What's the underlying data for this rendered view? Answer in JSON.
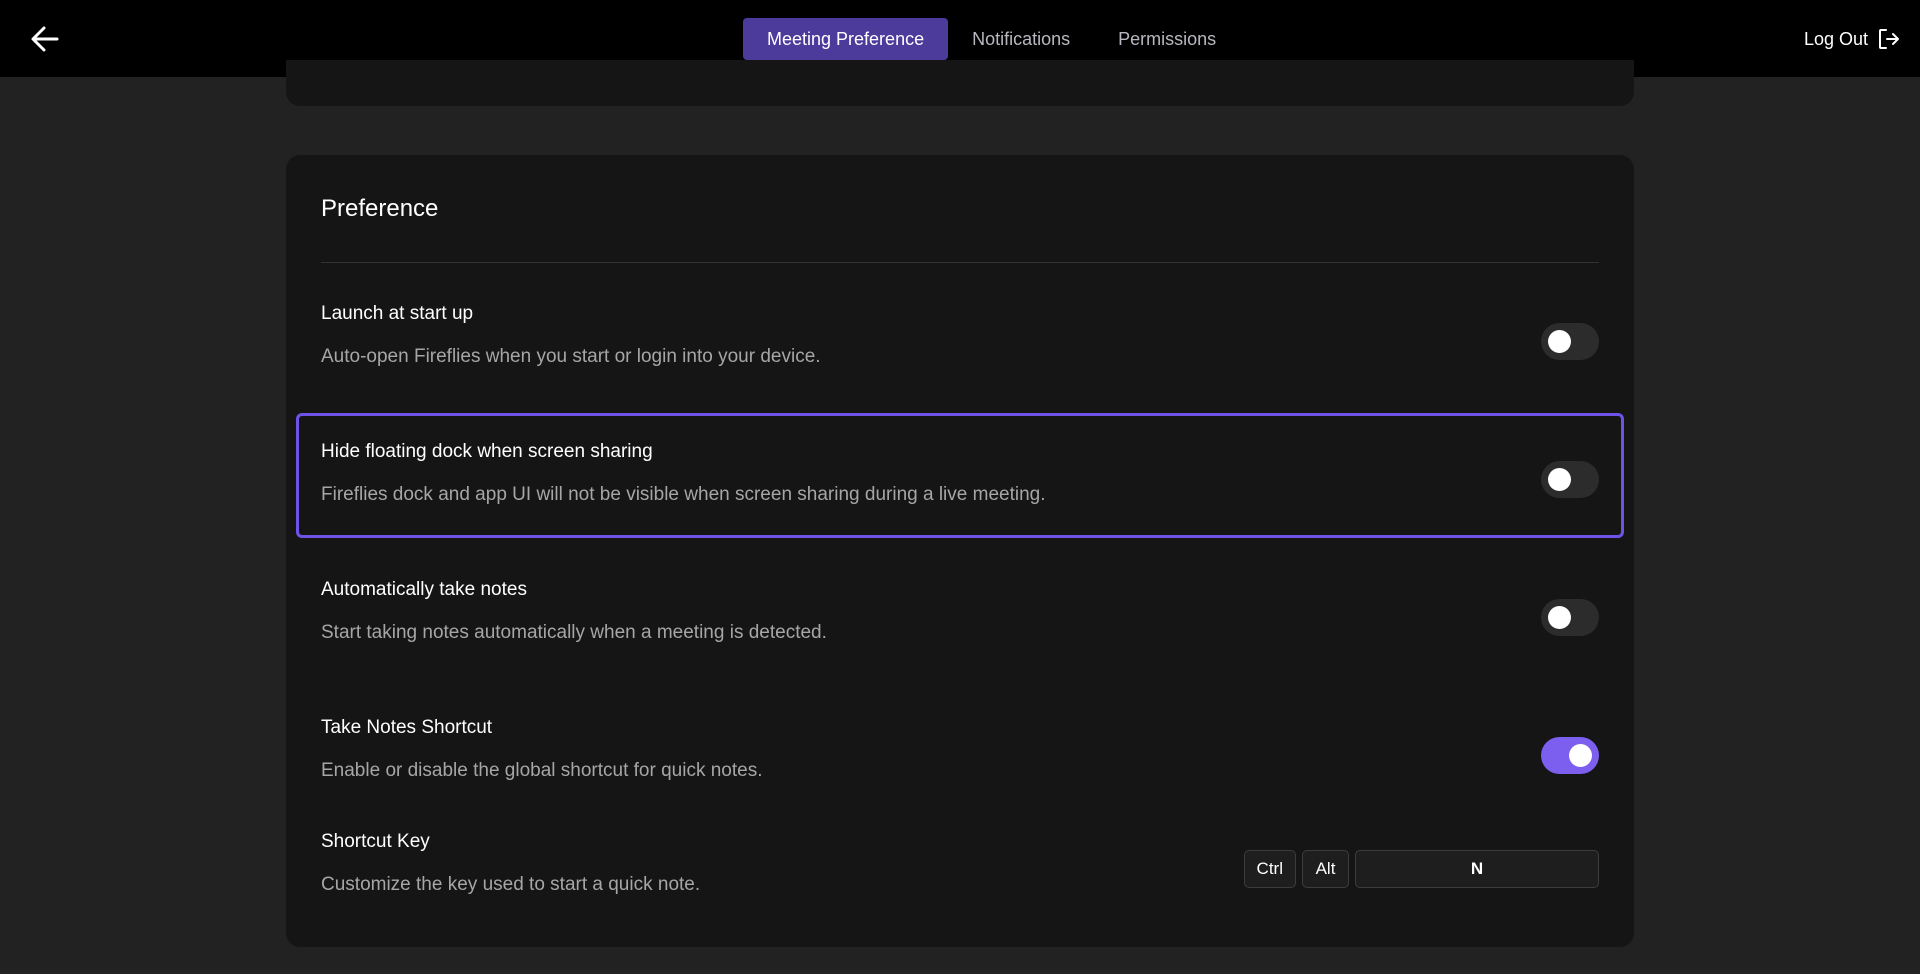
{
  "nav": {
    "tabs": [
      {
        "label": "Meeting Preference",
        "active": true
      },
      {
        "label": "Notifications",
        "active": false
      },
      {
        "label": "Permissions",
        "active": false
      }
    ],
    "logout_label": "Log Out"
  },
  "preference": {
    "title": "Preference",
    "settings": [
      {
        "title": "Launch at start up",
        "description": "Auto-open Fireflies when you start or login into your device.",
        "enabled": false
      },
      {
        "title": "Hide floating dock when screen sharing",
        "description": "Fireflies dock and app UI will not be visible when screen sharing during a live meeting.",
        "enabled": false
      },
      {
        "title": "Automatically take notes",
        "description": "Start taking notes automatically when a meeting is detected.",
        "enabled": false
      },
      {
        "title": "Take Notes Shortcut",
        "description": "Enable or disable the global shortcut for quick notes.",
        "enabled": true
      }
    ],
    "shortcut": {
      "title": "Shortcut Key",
      "description": "Customize the key used to start a quick note.",
      "keys": [
        "Ctrl",
        "Alt",
        "N"
      ]
    }
  },
  "colors": {
    "accent": "#6f52e6",
    "active_tab": "#4d3b9c",
    "toggle_on": "#7d5ff0"
  },
  "icons": [
    "arrow-left-icon",
    "logout-icon"
  ]
}
